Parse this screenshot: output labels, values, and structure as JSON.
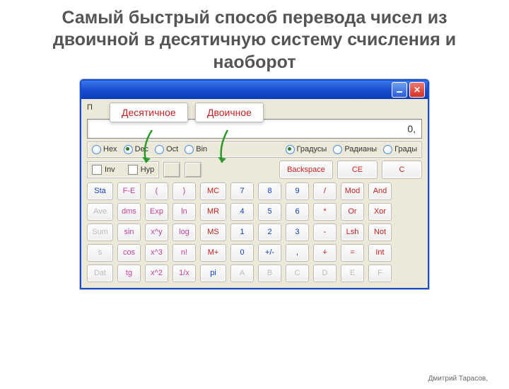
{
  "title": "Самый быстрый способ перевода чисел из двоичной в десятичную систему счисления и наоборот",
  "callouts": {
    "dec": "Десятичное",
    "bin": "Двоичное"
  },
  "window": {
    "menu": "П",
    "display": "0,",
    "bases": {
      "hex": "Hex",
      "dec": "Dec",
      "oct": "Oct",
      "bin": "Bin"
    },
    "angles": {
      "deg": "Градусы",
      "rad": "Радианы",
      "grad": "Грады"
    },
    "checks": {
      "inv": "Inv",
      "hyp": "Hyp"
    },
    "actions": {
      "back": "Backspace",
      "ce": "CE",
      "c": "C"
    },
    "rows": [
      [
        "Sta",
        "F-E",
        "(",
        ")",
        "MC",
        "7",
        "8",
        "9",
        "/",
        "Mod",
        "And"
      ],
      [
        "Ave",
        "dms",
        "Exp",
        "ln",
        "MR",
        "4",
        "5",
        "6",
        "*",
        "Or",
        "Xor"
      ],
      [
        "Sum",
        "sin",
        "x^y",
        "log",
        "MS",
        "1",
        "2",
        "3",
        "-",
        "Lsh",
        "Not"
      ],
      [
        "s",
        "cos",
        "x^3",
        "n!",
        "M+",
        "0",
        "+/-",
        ",",
        "+",
        "=",
        "Int"
      ],
      [
        "Dat",
        "tg",
        "x^2",
        "1/x",
        "pi",
        "A",
        "B",
        "C",
        "D",
        "E",
        "F"
      ]
    ]
  },
  "footer": {
    "author": "Дмитрий Тарасов,",
    "url": ""
  }
}
